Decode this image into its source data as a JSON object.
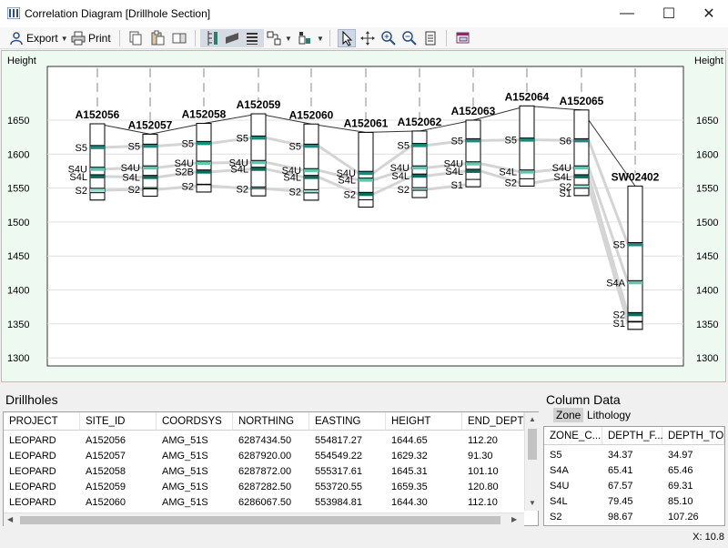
{
  "window": {
    "title": "Correlation Diagram [Drillhole Section]",
    "minimize_glyph": "—",
    "maximize_glyph": "☐",
    "close_glyph": "✕"
  },
  "toolbar": {
    "export_label": "Export",
    "print_label": "Print"
  },
  "diagram": {
    "left_axis_title": "Height",
    "right_axis_title": "Height",
    "y_ticks": [
      1650,
      1600,
      1550,
      1500,
      1450,
      1400,
      1350,
      1300
    ],
    "holes": [
      {
        "id": "A152056",
        "collar": 1644.65,
        "depth": 112.2,
        "labels": [
          {
            "t": "S5",
            "h": 1610
          },
          {
            "t": "S4U",
            "h": 1578
          },
          {
            "t": "S4L",
            "h": 1567
          },
          {
            "t": "S2",
            "h": 1547
          }
        ]
      },
      {
        "id": "A152057",
        "collar": 1629.32,
        "depth": 91.3,
        "labels": [
          {
            "t": "S5",
            "h": 1612
          },
          {
            "t": "S4U",
            "h": 1580
          },
          {
            "t": "S4L",
            "h": 1566
          },
          {
            "t": "S2",
            "h": 1548
          }
        ]
      },
      {
        "id": "A152058",
        "collar": 1645.31,
        "depth": 101.1,
        "labels": [
          {
            "t": "S5",
            "h": 1616
          },
          {
            "t": "S4U",
            "h": 1587
          },
          {
            "t": "S2B",
            "h": 1574
          },
          {
            "t": "S2",
            "h": 1553
          }
        ]
      },
      {
        "id": "A152059",
        "collar": 1659.35,
        "depth": 120.8,
        "labels": [
          {
            "t": "S5",
            "h": 1624
          },
          {
            "t": "S4U",
            "h": 1588
          },
          {
            "t": "S4L",
            "h": 1578
          },
          {
            "t": "S2",
            "h": 1549
          }
        ]
      },
      {
        "id": "A152060",
        "collar": 1644.3,
        "depth": 112.1,
        "labels": [
          {
            "t": "S5",
            "h": 1612
          },
          {
            "t": "S4U",
            "h": 1576
          },
          {
            "t": "S4L",
            "h": 1566
          },
          {
            "t": "S2",
            "h": 1545
          }
        ]
      },
      {
        "id": "A152061",
        "collar": 1632.0,
        "depth": 110.0,
        "labels": [
          {
            "t": "S4U",
            "h": 1572
          },
          {
            "t": "S4L",
            "h": 1562
          },
          {
            "t": "S2",
            "h": 1541
          }
        ]
      },
      {
        "id": "A152062",
        "collar": 1634.0,
        "depth": 98.0,
        "labels": [
          {
            "t": "S5",
            "h": 1613
          },
          {
            "t": "S4U",
            "h": 1580
          },
          {
            "t": "S4L",
            "h": 1568
          },
          {
            "t": "S2",
            "h": 1548
          }
        ]
      },
      {
        "id": "A152063",
        "collar": 1650.0,
        "depth": 98.0,
        "labels": [
          {
            "t": "S5",
            "h": 1620
          },
          {
            "t": "S4U",
            "h": 1586
          },
          {
            "t": "S4L",
            "h": 1575
          },
          {
            "t": "S1",
            "h": 1555
          }
        ]
      },
      {
        "id": "A152064",
        "collar": 1671.0,
        "depth": 118.0,
        "labels": [
          {
            "t": "S5",
            "h": 1621
          },
          {
            "t": "S4L",
            "h": 1574
          },
          {
            "t": "S2",
            "h": 1558
          }
        ]
      },
      {
        "id": "A152065",
        "collar": 1665.0,
        "depth": 126.0,
        "labels": [
          {
            "t": "S6",
            "h": 1620
          },
          {
            "t": "S4U",
            "h": 1580
          },
          {
            "t": "S4L",
            "h": 1567
          },
          {
            "t": "S2",
            "h": 1552
          },
          {
            "t": "S1",
            "h": 1543
          }
        ]
      },
      {
        "id": "SW02402",
        "collar": 1553.0,
        "depth": 211.0,
        "labels": [
          {
            "t": "S5",
            "h": 1467
          },
          {
            "t": "S4A",
            "h": 1411
          },
          {
            "t": "S2",
            "h": 1364
          },
          {
            "t": "S1",
            "h": 1351
          }
        ]
      }
    ]
  },
  "drillholes": {
    "title": "Drillholes",
    "columns": [
      "PROJECT",
      "SITE_ID",
      "COORDSYS",
      "NORTHING",
      "EASTING",
      "HEIGHT",
      "END_DEPTH"
    ],
    "rows": [
      [
        "LEOPARD",
        "A152056",
        "AMG_51S",
        "6287434.50",
        "554817.27",
        "1644.65",
        "112.20"
      ],
      [
        "LEOPARD",
        "A152057",
        "AMG_51S",
        "6287920.00",
        "554549.22",
        "1629.32",
        "91.30"
      ],
      [
        "LEOPARD",
        "A152058",
        "AMG_51S",
        "6287872.00",
        "555317.61",
        "1645.31",
        "101.10"
      ],
      [
        "LEOPARD",
        "A152059",
        "AMG_51S",
        "6287282.50",
        "553720.55",
        "1659.35",
        "120.80"
      ],
      [
        "LEOPARD",
        "A152060",
        "AMG_51S",
        "6286067.50",
        "553984.81",
        "1644.30",
        "112.10"
      ]
    ]
  },
  "column_data": {
    "title": "Column Data",
    "tabs": [
      "Zone",
      "Lithology"
    ],
    "columns": [
      "ZONE_C...",
      "DEPTH_F...",
      "DEPTH_TO"
    ],
    "rows": [
      [
        "S5",
        "34.37",
        "34.97"
      ],
      [
        "S4A",
        "65.41",
        "65.46"
      ],
      [
        "S4U",
        "67.57",
        "69.31"
      ],
      [
        "S4L",
        "79.45",
        "85.10"
      ],
      [
        "S2",
        "98.67",
        "107.26"
      ]
    ]
  },
  "status": {
    "coord_text": "X: 10.8"
  }
}
